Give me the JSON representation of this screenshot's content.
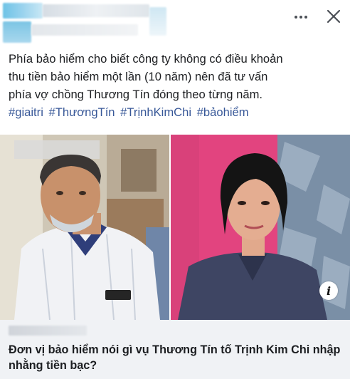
{
  "post": {
    "body_lines": [
      "Phía bảo hiểm cho biết công ty không có điều khoản",
      "thu tiền bảo hiểm một lần (10 năm) nên đã tư vấn",
      "phía vợ chồng Thương Tín đóng theo từng năm."
    ],
    "hashtags": [
      "#giaitri",
      "#ThươngTín",
      "#TrịnhKimChi",
      "#bảohiểm"
    ]
  },
  "header": {
    "more_icon": "more-horizontal-icon",
    "close_icon": "close-icon"
  },
  "media": {
    "info_label": "i",
    "left_image": "older man in white patterned shirt wearing face mask pulled under chin",
    "right_image": "woman with dark hair in dark button shirt against pink and patterned background"
  },
  "link": {
    "title": "Đơn vị bảo hiểm nói gì vụ Thương Tín tố Trịnh Kim Chi nhập nhằng tiền bạc?"
  },
  "colors": {
    "hashtag": "#385898",
    "text": "#1c1e21",
    "link_bg": "#f0f2f5"
  }
}
